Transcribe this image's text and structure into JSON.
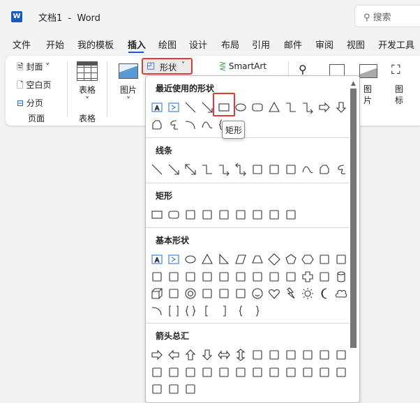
{
  "app": {
    "title": "文档1  -  Word",
    "search_placeholder": "搜索",
    "logo": "W"
  },
  "tabs": [
    "文件",
    "开始",
    "我的模板",
    "插入",
    "绘图",
    "设计",
    "布局",
    "引用",
    "邮件",
    "审阅",
    "视图",
    "开发工具"
  ],
  "ribbon": {
    "cover": "封面",
    "blank_page": "空白页",
    "page_break": "分页",
    "pages_group": "页面",
    "table": "表格",
    "tables_group": "表格",
    "picture": "图片",
    "shapes": "形状",
    "smartart": "SmartArt",
    "screenshot_label": "图\n片",
    "icons_label": "图\n标"
  },
  "panel": {
    "tooltip": "矩形",
    "sections": [
      {
        "title": "最近使用的形状",
        "rows": [
          [
            "textbox",
            "vertical-textbox",
            "line",
            "arrow-line",
            "rect",
            "oval",
            "rounded-rect",
            "triangle",
            "elbow-connector",
            "elbow-arrow",
            "right-arrow",
            "down-arrow"
          ],
          [
            "freeform",
            "scribble",
            "arc",
            "curve",
            "brace"
          ]
        ]
      },
      {
        "title": "线条",
        "rows": [
          [
            "line",
            "arrow-line",
            "double-arrow-line",
            "elbow-connector",
            "elbow-arrow",
            "elbow-double-arrow",
            "curve-connector",
            "curve-arrow",
            "curve-double-arrow",
            "curve",
            "freeform",
            "scribble"
          ]
        ]
      },
      {
        "title": "矩形",
        "rows": [
          [
            "rect",
            "rounded-rect",
            "snip-rect",
            "snip2-rect",
            "snip-diag-rect",
            "snip-round-rect",
            "round1-rect",
            "round2-rect",
            "round-diag-rect"
          ]
        ]
      },
      {
        "title": "基本形状",
        "rows": [
          [
            "textbox",
            "vertical-textbox",
            "oval",
            "triangle",
            "right-triangle",
            "parallelogram",
            "trapezoid",
            "diamond",
            "pentagon",
            "hexagon",
            "heptagon",
            "octagon"
          ],
          [
            "decagon",
            "dodecagon",
            "pie",
            "chord",
            "teardrop",
            "frame",
            "half-frame",
            "l-shape",
            "diagonal-stripe",
            "cross",
            "plaque",
            "can"
          ],
          [
            "cube",
            "bevel",
            "donut",
            "no-symbol",
            "block-arc",
            "folded-corner",
            "smiley",
            "heart",
            "lightning",
            "sun",
            "moon",
            "cloud"
          ],
          [
            "arc",
            "bracket-pair",
            "brace-pair",
            "left-bracket",
            "right-bracket",
            "left-brace",
            "right-brace"
          ]
        ]
      },
      {
        "title": "箭头总汇",
        "rows": [
          [
            "right-arrow",
            "left-arrow",
            "up-arrow",
            "down-arrow",
            "left-right-arrow",
            "up-down-arrow",
            "quad-arrow",
            "left-right-up-arrow",
            "bent-arrow",
            "u-turn-arrow",
            "left-up-arrow",
            "bent-up-arrow"
          ],
          [
            "curved-right-arrow",
            "curved-left-arrow",
            "curved-up-arrow",
            "curved-down-arrow",
            "striped-arrow",
            "notched-arrow",
            "pentagon-arrow",
            "chevron",
            "right-callout",
            "down-callout",
            "left-callout",
            "up-callout"
          ],
          [
            "quad-callout",
            "left-right-callout",
            "circular-arrow"
          ]
        ]
      }
    ]
  }
}
